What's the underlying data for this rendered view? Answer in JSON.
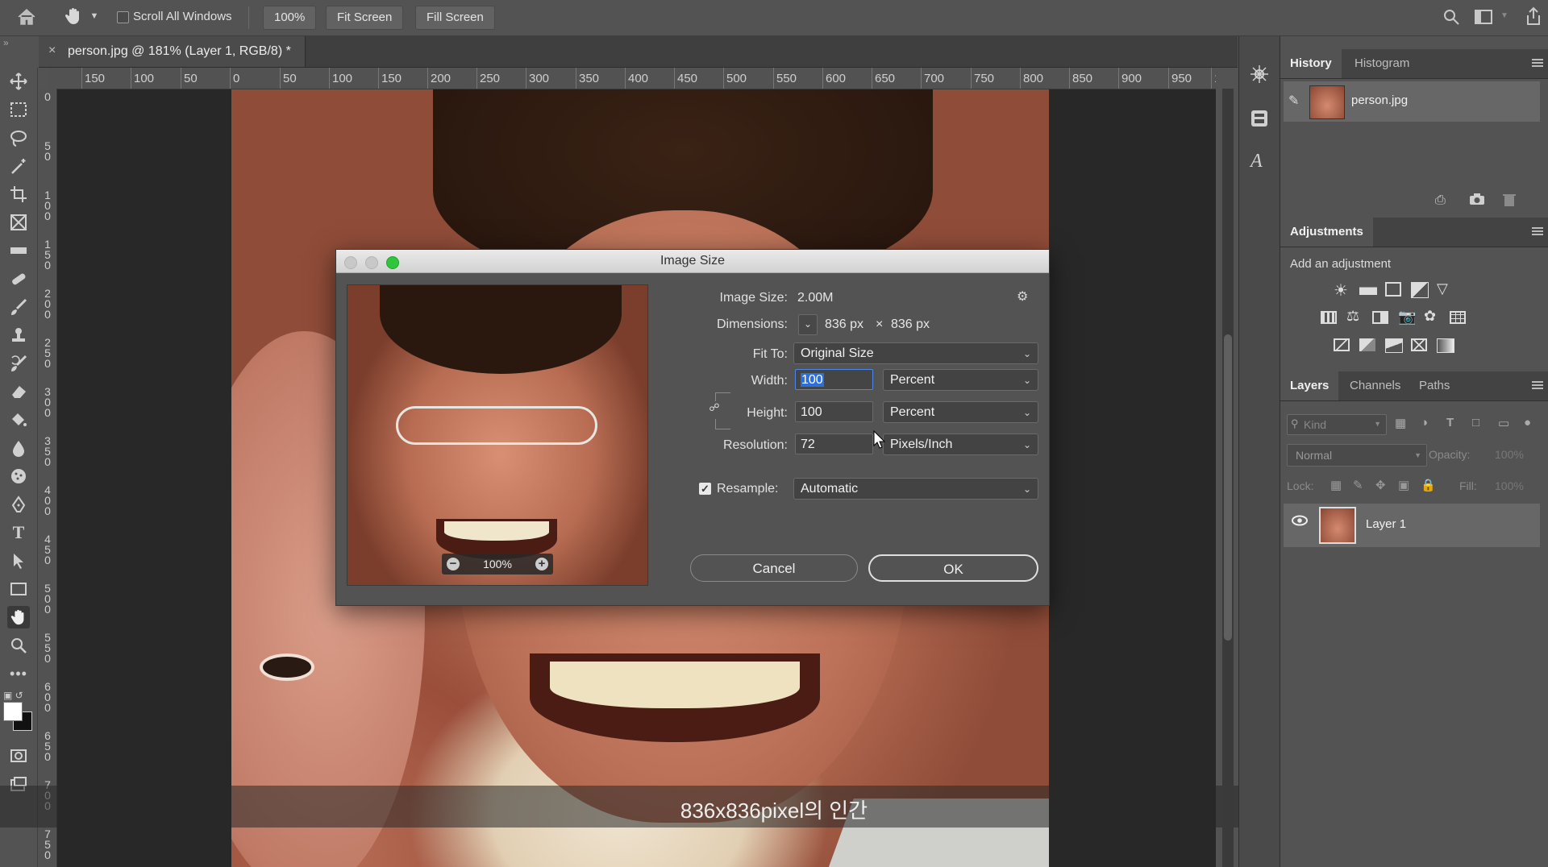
{
  "options_bar": {
    "scroll_all_label": "Scroll All Windows",
    "zoom_value": "100%",
    "fit_screen": "Fit Screen",
    "fill_screen": "Fill Screen"
  },
  "document_tab": {
    "title": "person.jpg @ 181% (Layer 1, RGB/8) *",
    "close": "×"
  },
  "ruler": {
    "h_ticks": [
      "150",
      "100",
      "50",
      "0",
      "50",
      "100",
      "150",
      "200",
      "250",
      "300",
      "350",
      "400",
      "450",
      "500",
      "550",
      "600",
      "650",
      "700",
      "750",
      "800",
      "850",
      "900",
      "950",
      "1"
    ],
    "v_ticks": [
      "0",
      "5\n0",
      "1\n0\n0",
      "1\n5\n0",
      "2\n0\n0",
      "2\n5\n0",
      "3\n0\n0",
      "3\n5\n0",
      "4\n0\n0",
      "4\n5\n0",
      "5\n0\n0",
      "5\n5\n0",
      "6\n0\n0",
      "6\n5\n0",
      "7\n0\n0",
      "7\n5\n0"
    ]
  },
  "dialog": {
    "title": "Image Size",
    "image_size_label": "Image Size:",
    "image_size_value": "2.00M",
    "dimensions_label": "Dimensions:",
    "dim_w": "836 px",
    "dim_x": "×",
    "dim_h": "836 px",
    "fit_to_label": "Fit To:",
    "fit_to_value": "Original Size",
    "width_label": "Width:",
    "width_value": "100",
    "width_unit": "Percent",
    "height_label": "Height:",
    "height_value": "100",
    "height_unit": "Percent",
    "resolution_label": "Resolution:",
    "resolution_value": "72",
    "resolution_unit": "Pixels/Inch",
    "resample_label": "Resample:",
    "resample_checked": true,
    "resample_value": "Automatic",
    "preview_zoom": "100%",
    "cancel": "Cancel",
    "ok": "OK"
  },
  "panels": {
    "history_tab": "History",
    "histogram_tab": "Histogram",
    "history_item": "person.jpg",
    "adjustments_tab": "Adjustments",
    "add_adjustment": "Add an adjustment",
    "layers_tab": "Layers",
    "channels_tab": "Channels",
    "paths_tab": "Paths",
    "kind_placeholder": "Kind",
    "blend_mode": "Normal",
    "opacity_label": "Opacity:",
    "opacity_value": "100%",
    "lock_label": "Lock:",
    "fill_label": "Fill:",
    "fill_value": "100%",
    "layer_name": "Layer 1"
  },
  "subtitle": "836x836pixel의 인간",
  "colors": {
    "accent": "#2d6fd8",
    "traffic_green": "#2fc63d"
  }
}
